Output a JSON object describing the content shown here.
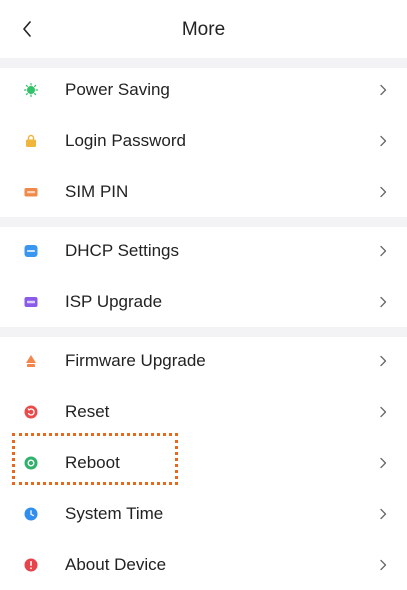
{
  "header": {
    "title": "More"
  },
  "items": [
    {
      "label": "Power Saving",
      "icon": "power-saving-icon",
      "color": "#32c26a"
    },
    {
      "label": "Login Password",
      "icon": "lock-icon",
      "color": "#f0b53c"
    },
    {
      "label": "SIM PIN",
      "icon": "sim-pin-icon",
      "color": "#f08a4a"
    },
    {
      "label": "DHCP Settings",
      "icon": "dhcp-icon",
      "color": "#3a97f0"
    },
    {
      "label": "ISP Upgrade",
      "icon": "isp-icon",
      "color": "#8a5be8"
    },
    {
      "label": "Firmware Upgrade",
      "icon": "firmware-icon",
      "color": "#f3874b"
    },
    {
      "label": "Reset",
      "icon": "reset-icon",
      "color": "#ea4a4a"
    },
    {
      "label": "Reboot",
      "icon": "reboot-icon",
      "color": "#2fb36a"
    },
    {
      "label": "System Time",
      "icon": "clock-icon",
      "color": "#2f8ef0"
    },
    {
      "label": "About Device",
      "icon": "info-icon",
      "color": "#e8424a"
    }
  ],
  "colors": {
    "highlight": "#e8681c",
    "separator": "#f3f3f5",
    "chevron": "#666666"
  }
}
